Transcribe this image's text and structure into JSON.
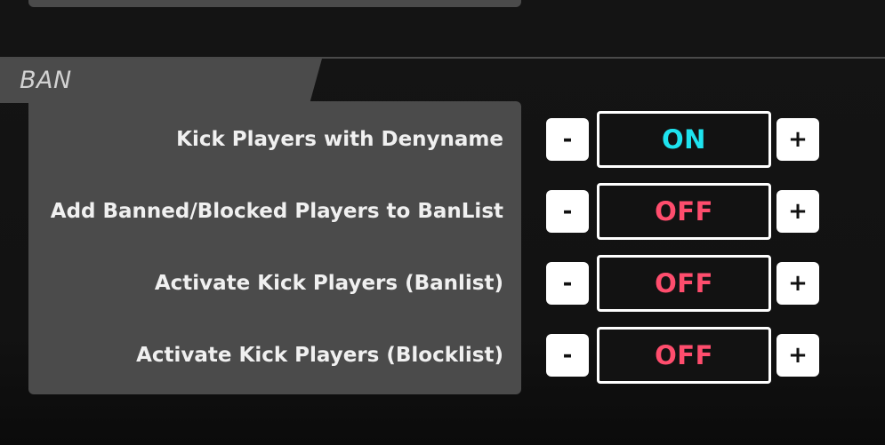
{
  "section": {
    "title": "BAN"
  },
  "settings": [
    {
      "label": "Kick Players with Denyname",
      "value": "ON",
      "state": "on"
    },
    {
      "label": "Add Banned/Blocked Players to BanList",
      "value": "OFF",
      "state": "off"
    },
    {
      "label": "Activate Kick Players (Banlist)",
      "value": "OFF",
      "state": "off"
    },
    {
      "label": "Activate Kick Players (Blocklist)",
      "value": "OFF",
      "state": "off"
    }
  ],
  "controls": {
    "decrement": "-",
    "increment": "+"
  },
  "colors": {
    "on": "#1ee3ef",
    "off": "#ff4d6d",
    "panel": "#4b4b4b",
    "background": "#121212"
  }
}
